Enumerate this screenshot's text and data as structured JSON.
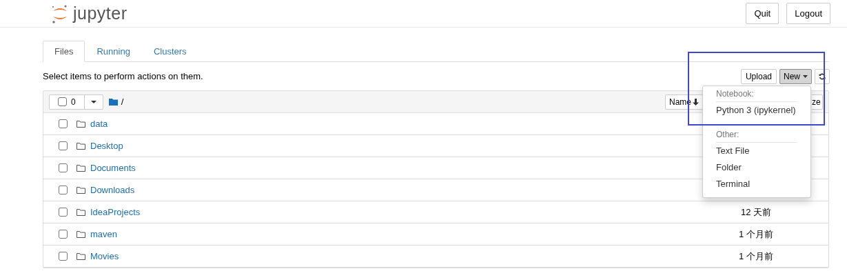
{
  "header": {
    "logo_text": "jupyter",
    "buttons": [
      "Quit",
      "Logout"
    ]
  },
  "tabs": [
    {
      "label": "Files",
      "selected": true
    },
    {
      "label": "Running",
      "selected": false
    },
    {
      "label": "Clusters",
      "selected": false
    }
  ],
  "toolbar": {
    "hint": "Select items to perform actions on them.",
    "upload": "Upload",
    "new": "New",
    "new_open": true
  },
  "list_header": {
    "selected_count": "0",
    "all_checked": false,
    "path": "/",
    "sort_button": "Name",
    "column_3": "ze"
  },
  "rows": [
    {
      "name": "data",
      "checked": false
    },
    {
      "name": "Desktop",
      "checked": false
    },
    {
      "name": "Documents",
      "checked": false
    },
    {
      "name": "Downloads",
      "checked": false
    },
    {
      "name": "IdeaProjects",
      "modified": "12 天前",
      "checked": false
    },
    {
      "name": "maven",
      "modified": "1 个月前",
      "checked": false
    },
    {
      "name": "Movies",
      "modified": "1 个月前",
      "checked": false
    }
  ],
  "new_menu": [
    {
      "kind": "header",
      "label": "Notebook:"
    },
    {
      "kind": "item",
      "label": "Python 3 (ipykernel)"
    },
    {
      "kind": "divider_header",
      "label": "Other:"
    },
    {
      "kind": "item",
      "label": "Text File"
    },
    {
      "kind": "item",
      "label": "Folder"
    },
    {
      "kind": "item",
      "label": "Terminal"
    }
  ]
}
